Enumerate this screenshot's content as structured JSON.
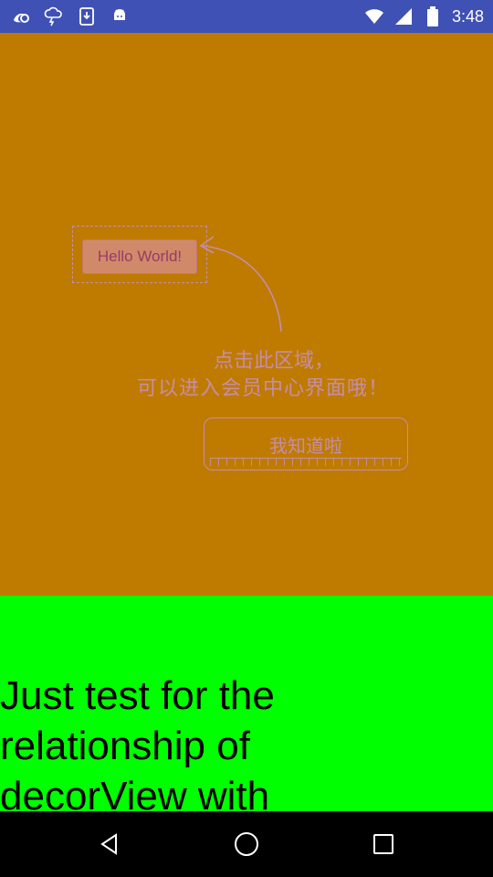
{
  "status_bar": {
    "time": "3:48",
    "left_icons": [
      "uc-browser-icon",
      "weather-icon",
      "download-icon",
      "android-icon"
    ],
    "right_icons": [
      "wifi-icon",
      "signal-icon",
      "battery-icon"
    ]
  },
  "guide_overlay": {
    "hello_button_label": "Hello World!",
    "hint_line_1": "点击此区域，",
    "hint_line_2": "可以进入会员中心界面哦！",
    "confirm_button_label": "我知道啦"
  },
  "content": {
    "body_text": "Just test for the relationship of decorView with"
  },
  "nav_bar": {
    "buttons": [
      "back-icon",
      "home-icon",
      "recents-icon"
    ]
  },
  "colors": {
    "status_bar": "#3f51b5",
    "overlay": "#bf7a00",
    "green_area": "#00ff00",
    "nav_bar": "#000000",
    "hint_text": "#c58ea8"
  }
}
